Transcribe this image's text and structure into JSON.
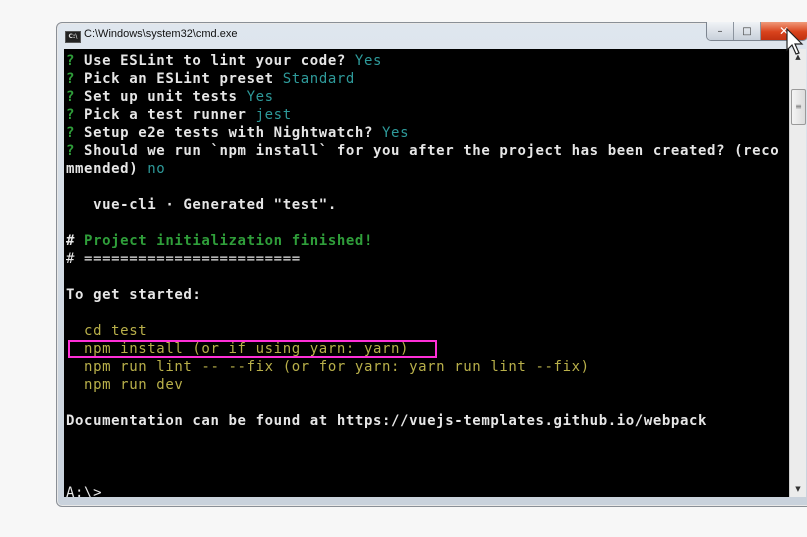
{
  "window": {
    "title": "C:\\Windows\\system32\\cmd.exe",
    "icon": "cmd-icon",
    "icon_text": "C:\\",
    "controls": {
      "minimize": "–",
      "maximize": "□",
      "close": "✕"
    }
  },
  "terminal": {
    "lines": [
      {
        "prefix": "?",
        "text": " Use ESLint to lint your code? ",
        "answer": "Yes"
      },
      {
        "prefix": "?",
        "text": " Pick an ESLint preset ",
        "answer": "Standard"
      },
      {
        "prefix": "?",
        "text": " Set up unit tests ",
        "answer": "Yes"
      },
      {
        "prefix": "?",
        "text": " Pick a test runner ",
        "answer": "jest"
      },
      {
        "prefix": "?",
        "text": " Setup e2e tests with Nightwatch? ",
        "answer": "Yes"
      },
      {
        "prefix": "?",
        "text": " Should we run `npm install` for you after the project has been created? (reco",
        "answer": ""
      },
      {
        "prefix": "",
        "text": "mmended) ",
        "answer": "no"
      }
    ],
    "generated": "   vue-cli · Generated \"test\".",
    "finished_hash": "#",
    "finished_text": " Project initialization finished!",
    "separator": "# ========================",
    "get_started": "To get started:",
    "steps": [
      "  cd test",
      "  npm install (or if using yarn: yarn)",
      "  npm run lint -- --fix (or for yarn: yarn run lint --fix)",
      "  npm run dev"
    ],
    "highlighted_step_index": 1,
    "documentation": "Documentation can be found at https://vuejs-templates.github.io/webpack",
    "prompt": "A:\\>"
  },
  "scrollbar": {
    "up": "▲",
    "down": "▼",
    "thumb_grip": "≡",
    "position_fraction": 0.1
  },
  "colors": {
    "highlight_box": "#ff2fd8",
    "answer": "#2e9a9a",
    "success": "#2f9e3a",
    "command": "#b9b04a"
  }
}
